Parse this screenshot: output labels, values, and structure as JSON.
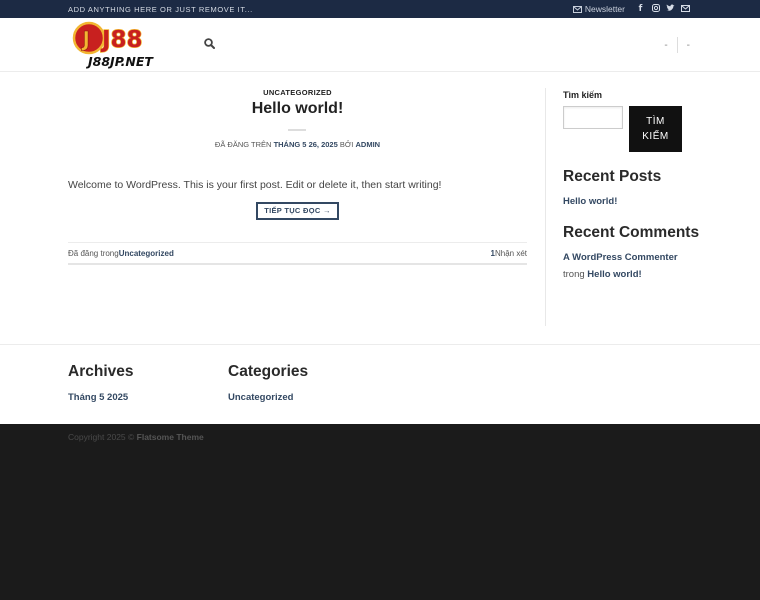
{
  "topbar": {
    "message": "ADD ANYTHING HERE OR JUST REMOVE IT...",
    "newsletter": "Newsletter",
    "social_icons": [
      "facebook-icon",
      "instagram-icon",
      "twitter-icon",
      "email-icon"
    ]
  },
  "header": {
    "logo_top": "J88",
    "logo_bottom": "J88JP.NET",
    "menu_right": [
      "-",
      "-"
    ]
  },
  "post": {
    "category": "UNCATEGORIZED",
    "title": "Hello world!",
    "meta_prefix": "ĐÃ ĐĂNG TRÊN",
    "meta_date": "THÁNG 5 26, 2025",
    "meta_by": "BỞI",
    "meta_author": "ADMIN",
    "excerpt": "Welcome to WordPress. This is your first post. Edit or delete it, then start writing!",
    "read_more": "TIẾP TỤC ĐỌC →",
    "posted_in": "Đã đăng trong",
    "posted_cat": "Uncategorized",
    "comments_count": "1",
    "comments_label": "Nhận xét"
  },
  "sidebar": {
    "search_label": "Tìm kiếm",
    "search_button_line1": "TÌM",
    "search_button_line2": "KIẾM",
    "recent_posts_title": "Recent Posts",
    "recent_posts": [
      "Hello world!"
    ],
    "recent_comments_title": "Recent Comments",
    "comment_author": "A WordPress Commenter",
    "comment_on": "trong",
    "comment_post": "Hello world!"
  },
  "widgets": {
    "archives_title": "Archives",
    "archives": [
      "Tháng 5 2025"
    ],
    "categories_title": "Categories",
    "categories": [
      "Uncategorized"
    ]
  },
  "footer": {
    "copyright": "Copyright 2025 ©",
    "theme": "Flatsome Theme"
  },
  "colors": {
    "topbar_bg": "#1c2a44",
    "link": "#334862",
    "footer_bg": "#1b1b1b",
    "logo_red": "#c8201f",
    "logo_gold": "#f2b632"
  }
}
